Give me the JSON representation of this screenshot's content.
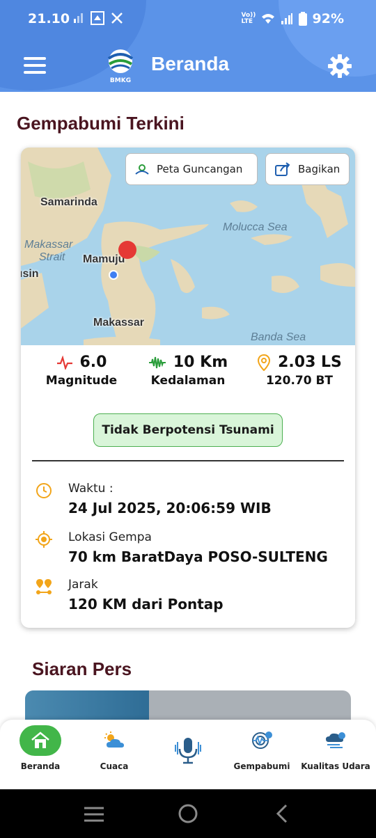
{
  "status_bar": {
    "time": "21.10",
    "network": "Vo)) LTE",
    "battery": "92%"
  },
  "header": {
    "logo_text": "BMKG",
    "title": "Beranda"
  },
  "section_title": "Gempabumi Terkini",
  "map": {
    "buttons": {
      "shake_map": "Peta Guncangan",
      "share": "Bagikan"
    },
    "labels": {
      "samarinda": "Samarinda",
      "makassar_strait_1": "Makassar",
      "makassar_strait_2": "Strait",
      "mamuju": "Mamuju",
      "sin": "ısin",
      "makassar": "Makassar",
      "molucca": "Molucca Sea",
      "banda": "Banda Sea"
    }
  },
  "stats": {
    "magnitude": {
      "value": "6.0",
      "label": "Magnitude"
    },
    "depth": {
      "value": "10 Km",
      "label": "Kedalaman"
    },
    "location": {
      "lat": "2.03 LS",
      "lon": "120.70 BT"
    }
  },
  "tsunami_status": "Tidak Berpotensi Tsunami",
  "details": {
    "time": {
      "label": "Waktu :",
      "value": "24 Jul 2025, 20:06:59 WIB"
    },
    "place": {
      "label": "Lokasi Gempa",
      "value": "70 km BaratDaya POSO-SULTENG"
    },
    "distance": {
      "label": "Jarak",
      "value": "120 KM dari Pontap"
    }
  },
  "press_section_title": "Siaran Pers",
  "bottom_nav": [
    {
      "label": "Beranda"
    },
    {
      "label": "Cuaca"
    },
    {
      "label": ""
    },
    {
      "label": "Gempabumi"
    },
    {
      "label": "Kualitas Udara"
    }
  ],
  "colors": {
    "header": "#5b93e8",
    "accent_red": "#e53935",
    "accent_green": "#42b649",
    "title": "#4a1520",
    "icon_orange": "#f2a51a"
  }
}
